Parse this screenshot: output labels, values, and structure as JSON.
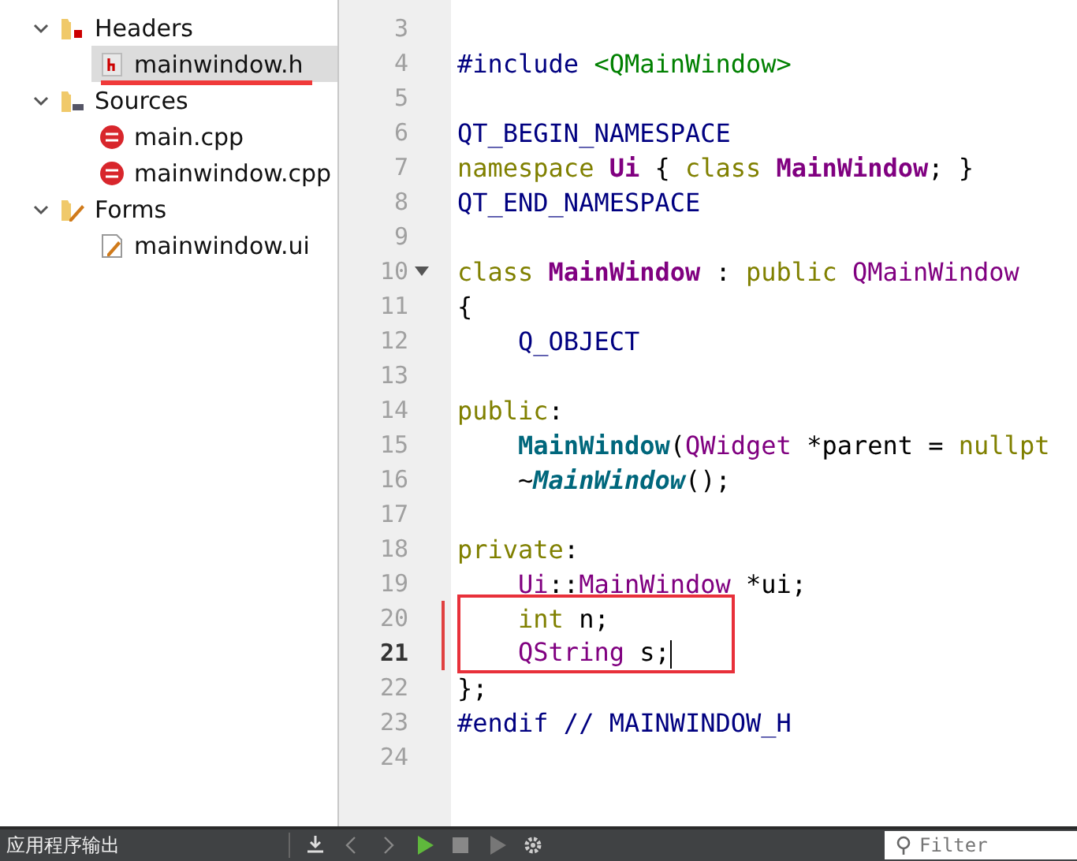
{
  "project_tree": [
    {
      "label": "Headers",
      "kind": "headers",
      "expanded": true,
      "children": [
        {
          "label": "mainwindow.h",
          "kind": "header",
          "selected": true,
          "underlined": true
        }
      ]
    },
    {
      "label": "Sources",
      "kind": "sources",
      "expanded": true,
      "children": [
        {
          "label": "main.cpp",
          "kind": "source",
          "selected": false,
          "underlined": false
        },
        {
          "label": "mainwindow.cpp",
          "kind": "source",
          "selected": false,
          "underlined": false
        }
      ]
    },
    {
      "label": "Forms",
      "kind": "forms",
      "expanded": true,
      "children": [
        {
          "label": "mainwindow.ui",
          "kind": "form",
          "selected": false,
          "underlined": false
        }
      ]
    }
  ],
  "editor": {
    "lines": [
      {
        "number": "3"
      },
      {
        "number": "4",
        "tokens": [
          {
            "kind": "macro",
            "text": "#include "
          },
          {
            "kind": "string",
            "text": "<QMainWindow>"
          }
        ]
      },
      {
        "number": "5"
      },
      {
        "number": "6",
        "tokens": [
          {
            "kind": "macro",
            "text": "QT_BEGIN_NAMESPACE"
          }
        ]
      },
      {
        "number": "7",
        "tokens": [
          {
            "kind": "keyword",
            "text": "namespace "
          },
          {
            "kind": "type",
            "text": "Ui"
          },
          {
            "kind": "plain",
            "text": " { "
          },
          {
            "kind": "keyword",
            "text": "class "
          },
          {
            "kind": "type",
            "text": "MainWindow"
          },
          {
            "kind": "plain",
            "text": "; }"
          }
        ]
      },
      {
        "number": "8",
        "tokens": [
          {
            "kind": "macro",
            "text": "QT_END_NAMESPACE"
          }
        ]
      },
      {
        "number": "9"
      },
      {
        "number": "10",
        "fold": true,
        "tokens": [
          {
            "kind": "keyword",
            "text": "class "
          },
          {
            "kind": "type",
            "text": "MainWindow"
          },
          {
            "kind": "plain",
            "text": " : "
          },
          {
            "kind": "keyword",
            "text": "public "
          },
          {
            "kind": "class",
            "text": "QMainWindow"
          }
        ]
      },
      {
        "number": "11",
        "tokens": [
          {
            "kind": "plain",
            "text": "{"
          }
        ]
      },
      {
        "number": "12",
        "tokens": [
          {
            "kind": "macro",
            "text": "    Q_OBJECT"
          }
        ]
      },
      {
        "number": "13"
      },
      {
        "number": "14",
        "tokens": [
          {
            "kind": "keyword",
            "text": "public"
          },
          {
            "kind": "plain",
            "text": ":"
          }
        ]
      },
      {
        "number": "15",
        "tokens": [
          {
            "kind": "function",
            "text": "    MainWindow"
          },
          {
            "kind": "plain",
            "text": "("
          },
          {
            "kind": "class",
            "text": "QWidget"
          },
          {
            "kind": "plain",
            "text": " *parent = "
          },
          {
            "kind": "keyword",
            "text": "nullpt"
          }
        ]
      },
      {
        "number": "16",
        "tokens": [
          {
            "kind": "plain",
            "text": "    ~"
          },
          {
            "kind": "virtual",
            "text": "MainWindow"
          },
          {
            "kind": "plain",
            "text": "();"
          }
        ]
      },
      {
        "number": "17"
      },
      {
        "number": "18",
        "tokens": [
          {
            "kind": "keyword",
            "text": "private"
          },
          {
            "kind": "plain",
            "text": ":"
          }
        ]
      },
      {
        "number": "19",
        "tokens": [
          {
            "kind": "class",
            "text": "    Ui"
          },
          {
            "kind": "plain",
            "text": "::"
          },
          {
            "kind": "class",
            "text": "MainWindow"
          },
          {
            "kind": "plain",
            "text": " *ui;"
          }
        ]
      },
      {
        "number": "20",
        "modified": true,
        "boxed": true,
        "tokens": [
          {
            "kind": "keyword",
            "text": "    int"
          },
          {
            "kind": "plain",
            "text": " n;"
          }
        ]
      },
      {
        "number": "21",
        "modified": true,
        "boxed": true,
        "current": true,
        "tokens": [
          {
            "kind": "class",
            "text": "    QString"
          },
          {
            "kind": "plain",
            "text": " s;"
          }
        ]
      },
      {
        "number": "22",
        "tokens": [
          {
            "kind": "plain",
            "text": "};"
          }
        ]
      },
      {
        "number": "23",
        "tokens": [
          {
            "kind": "macro",
            "text": "#endif // MAINWINDOW_H"
          }
        ]
      },
      {
        "number": "24"
      }
    ]
  },
  "output_pane": {
    "title": "应用程序输出",
    "filter": {
      "placeholder": "Filter"
    }
  }
}
